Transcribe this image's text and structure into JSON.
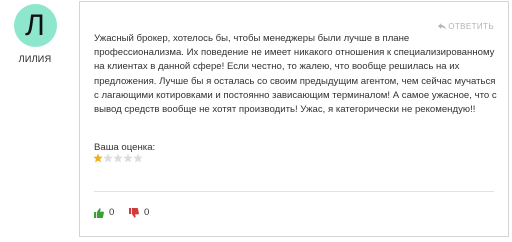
{
  "author": {
    "initial": "Л",
    "name": "ЛИЛИЯ"
  },
  "review": {
    "reply_label": "ОТВЕТИТЬ",
    "text": "Ужасный брокер, хотелось бы, чтобы менеджеры были лучше в плане профессионализма. Их поведение не имеет никакого отношения к специализированному на клиентах в данной сфере! Если честно, то жалею, что вообще решилась на их предложения. Лучше бы я осталась со своим предыдущим агентом, чем сейчас мучаться с лагающими котировками и постоянно зависающим терминалом! А самое ужасное, что с вывод средств вообще не хотят производить! Ужас, я категорически не рекомендую!!",
    "rating_label": "Ваша оценка:",
    "rating": 1,
    "rating_max": 5,
    "likes": "0",
    "dislikes": "0"
  },
  "colors": {
    "avatar_bg": "#8ee6cc",
    "star_filled": "#f2b01e",
    "star_empty": "#dddddd",
    "like": "#3aa13a",
    "dislike": "#d13b3b"
  },
  "icons": [
    "reply-arrow-icon",
    "star-icon",
    "thumbs-up-icon",
    "thumbs-down-icon"
  ]
}
